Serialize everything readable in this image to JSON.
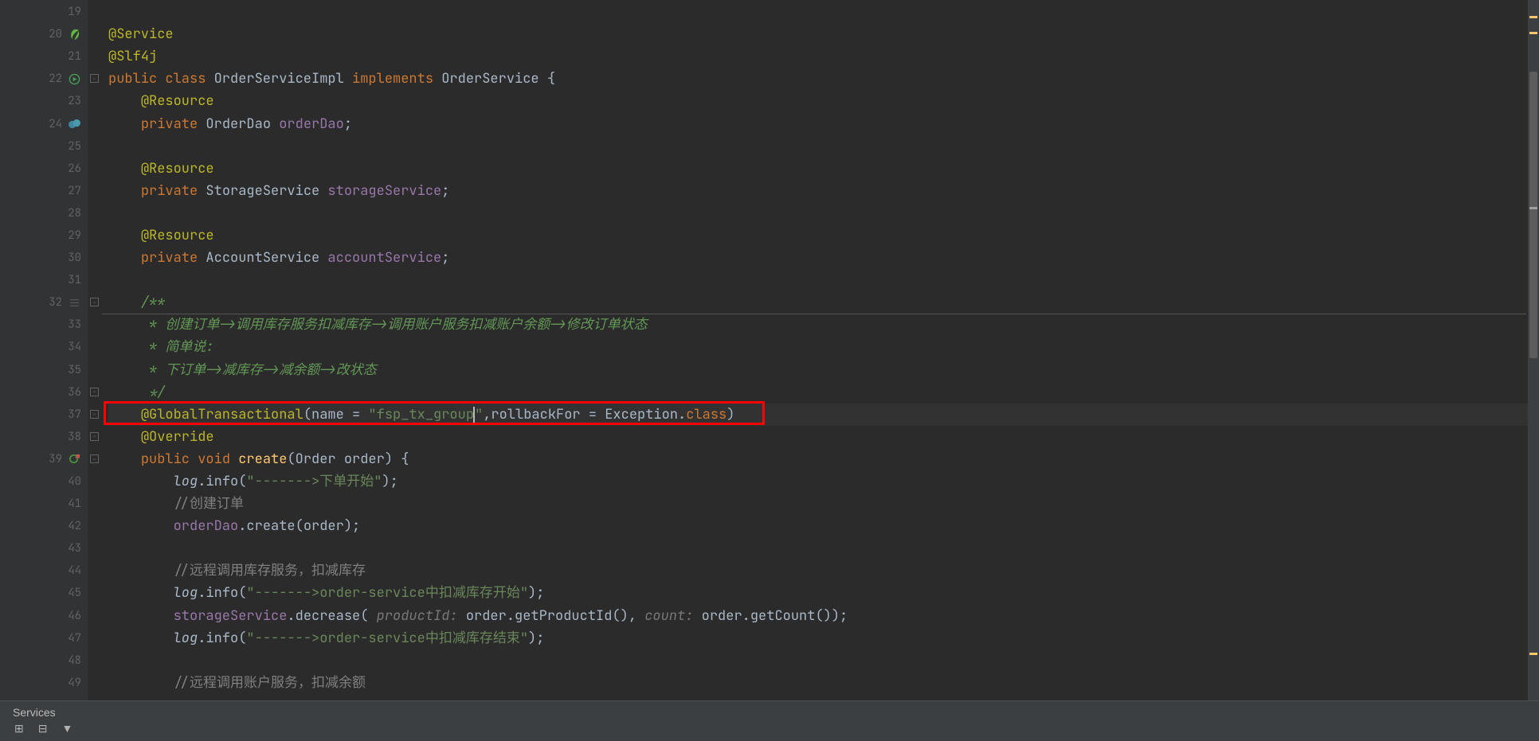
{
  "lines": [
    {
      "n": 19,
      "icons": [],
      "fold": "",
      "tokens": []
    },
    {
      "n": 20,
      "icons": [
        "leaf-green"
      ],
      "fold": "",
      "tokens": [
        {
          "t": "@Service",
          "c": "annotation"
        }
      ]
    },
    {
      "n": 21,
      "icons": [],
      "fold": "",
      "tokens": [
        {
          "t": "@Slf4j",
          "c": "annotation"
        }
      ]
    },
    {
      "n": 22,
      "icons": [
        "run-green"
      ],
      "fold": "open",
      "tokens": [
        {
          "t": "public class ",
          "c": "kw"
        },
        {
          "t": "OrderServiceImpl ",
          "c": "type"
        },
        {
          "t": "implements ",
          "c": "kw"
        },
        {
          "t": "OrderService {",
          "c": "type"
        }
      ]
    },
    {
      "n": 23,
      "icons": [],
      "fold": "",
      "tokens": [
        {
          "t": "    ",
          "c": ""
        },
        {
          "t": "@Resource",
          "c": "annotation"
        }
      ]
    },
    {
      "n": 24,
      "icons": [
        "bean"
      ],
      "fold": "",
      "tokens": [
        {
          "t": "    ",
          "c": ""
        },
        {
          "t": "private ",
          "c": "kw"
        },
        {
          "t": "OrderDao ",
          "c": "type"
        },
        {
          "t": "orderDao",
          "c": "field"
        },
        {
          "t": ";",
          "c": "punc"
        }
      ]
    },
    {
      "n": 25,
      "icons": [],
      "fold": "",
      "tokens": []
    },
    {
      "n": 26,
      "icons": [],
      "fold": "",
      "tokens": [
        {
          "t": "    ",
          "c": ""
        },
        {
          "t": "@Resource",
          "c": "annotation"
        }
      ]
    },
    {
      "n": 27,
      "icons": [],
      "fold": "",
      "tokens": [
        {
          "t": "    ",
          "c": ""
        },
        {
          "t": "private ",
          "c": "kw"
        },
        {
          "t": "StorageService ",
          "c": "type"
        },
        {
          "t": "storageService",
          "c": "field"
        },
        {
          "t": ";",
          "c": "punc"
        }
      ]
    },
    {
      "n": 28,
      "icons": [],
      "fold": "",
      "tokens": []
    },
    {
      "n": 29,
      "icons": [],
      "fold": "",
      "tokens": [
        {
          "t": "    ",
          "c": ""
        },
        {
          "t": "@Resource",
          "c": "annotation"
        }
      ]
    },
    {
      "n": 30,
      "icons": [],
      "fold": "",
      "tokens": [
        {
          "t": "    ",
          "c": ""
        },
        {
          "t": "private ",
          "c": "kw"
        },
        {
          "t": "AccountService ",
          "c": "type"
        },
        {
          "t": "accountService",
          "c": "field"
        },
        {
          "t": ";",
          "c": "punc"
        }
      ]
    },
    {
      "n": 31,
      "icons": [],
      "fold": "",
      "tokens": []
    },
    {
      "n": 32,
      "icons": [
        "line-sep"
      ],
      "fold": "open",
      "tokens": [
        {
          "t": "    ",
          "c": ""
        },
        {
          "t": "/**",
          "c": "comment-doc"
        }
      ]
    },
    {
      "n": 33,
      "icons": [],
      "fold": "",
      "tokens": [
        {
          "t": "     * ",
          "c": "comment-doc"
        },
        {
          "t": "创建订单->调用库存服务扣减库存->调用账户服务扣减账户余额->修改订单状态",
          "c": "comment-doc"
        }
      ]
    },
    {
      "n": 34,
      "icons": [],
      "fold": "",
      "tokens": [
        {
          "t": "     * ",
          "c": "comment-doc"
        },
        {
          "t": "简单说:",
          "c": "comment-doc"
        }
      ]
    },
    {
      "n": 35,
      "icons": [],
      "fold": "",
      "tokens": [
        {
          "t": "     * ",
          "c": "comment-doc"
        },
        {
          "t": "下订单->减库存->减余额->改状态",
          "c": "comment-doc"
        }
      ]
    },
    {
      "n": 36,
      "icons": [],
      "fold": "close",
      "tokens": [
        {
          "t": "     */",
          "c": "comment-doc"
        }
      ]
    },
    {
      "n": 37,
      "icons": [],
      "fold": "open",
      "highlight": true,
      "redbox": true,
      "tokens": [
        {
          "t": "    ",
          "c": ""
        },
        {
          "t": "@GlobalTransactional",
          "c": "annotation"
        },
        {
          "t": "(name = ",
          "c": "punc"
        },
        {
          "t": "\"fsp_tx_group",
          "c": "string"
        },
        {
          "t": "",
          "c": "caret"
        },
        {
          "t": "\"",
          "c": "string"
        },
        {
          "t": ",rollbackFor = Exception.",
          "c": "punc"
        },
        {
          "t": "class",
          "c": "kw"
        },
        {
          "t": ")",
          "c": "punc"
        }
      ]
    },
    {
      "n": 38,
      "icons": [],
      "fold": "close",
      "tokens": [
        {
          "t": "    ",
          "c": ""
        },
        {
          "t": "@Override",
          "c": "annotation"
        }
      ]
    },
    {
      "n": 39,
      "icons": [
        "override"
      ],
      "fold": "open",
      "tokens": [
        {
          "t": "    ",
          "c": ""
        },
        {
          "t": "public ",
          "c": "kw"
        },
        {
          "t": "void ",
          "c": "kw"
        },
        {
          "t": "create",
          "c": "method"
        },
        {
          "t": "(Order order) {",
          "c": "punc"
        }
      ]
    },
    {
      "n": 40,
      "icons": [],
      "fold": "",
      "tokens": [
        {
          "t": "        ",
          "c": ""
        },
        {
          "t": "log",
          "c": "var"
        },
        {
          "t": ".info(",
          "c": "punc"
        },
        {
          "t": "\"------->下单开始\"",
          "c": "string"
        },
        {
          "t": ");",
          "c": "punc"
        }
      ]
    },
    {
      "n": 41,
      "icons": [],
      "fold": "",
      "tokens": [
        {
          "t": "        ",
          "c": ""
        },
        {
          "t": "//创建订单",
          "c": "comment"
        }
      ]
    },
    {
      "n": 42,
      "icons": [],
      "fold": "",
      "tokens": [
        {
          "t": "        ",
          "c": ""
        },
        {
          "t": "orderDao",
          "c": "field"
        },
        {
          "t": ".create(order);",
          "c": "punc"
        }
      ]
    },
    {
      "n": 43,
      "icons": [],
      "fold": "",
      "tokens": []
    },
    {
      "n": 44,
      "icons": [],
      "fold": "",
      "tokens": [
        {
          "t": "        ",
          "c": ""
        },
        {
          "t": "//远程调用库存服务，扣减库存",
          "c": "comment"
        }
      ]
    },
    {
      "n": 45,
      "icons": [],
      "fold": "",
      "tokens": [
        {
          "t": "        ",
          "c": ""
        },
        {
          "t": "log",
          "c": "var"
        },
        {
          "t": ".info(",
          "c": "punc"
        },
        {
          "t": "\"------->order-service中扣减库存开始\"",
          "c": "string"
        },
        {
          "t": ");",
          "c": "punc"
        }
      ]
    },
    {
      "n": 46,
      "icons": [],
      "fold": "",
      "tokens": [
        {
          "t": "        ",
          "c": ""
        },
        {
          "t": "storageService",
          "c": "field"
        },
        {
          "t": ".decrease( ",
          "c": "punc"
        },
        {
          "t": "productId: ",
          "c": "param-hint"
        },
        {
          "t": "order.getProductId(), ",
          "c": "punc"
        },
        {
          "t": "count: ",
          "c": "param-hint"
        },
        {
          "t": "order.getCount());",
          "c": "punc"
        }
      ]
    },
    {
      "n": 47,
      "icons": [],
      "fold": "",
      "tokens": [
        {
          "t": "        ",
          "c": ""
        },
        {
          "t": "log",
          "c": "var"
        },
        {
          "t": ".info(",
          "c": "punc"
        },
        {
          "t": "\"------->order-service中扣减库存结束\"",
          "c": "string"
        },
        {
          "t": ");",
          "c": "punc"
        }
      ]
    },
    {
      "n": 48,
      "icons": [],
      "fold": "",
      "tokens": []
    },
    {
      "n": 49,
      "icons": [],
      "fold": "",
      "tokens": [
        {
          "t": "        ",
          "c": ""
        },
        {
          "t": "//远程调用账户服务，扣减余额",
          "c": "comment"
        }
      ]
    }
  ],
  "services_panel": {
    "title": "Services"
  }
}
